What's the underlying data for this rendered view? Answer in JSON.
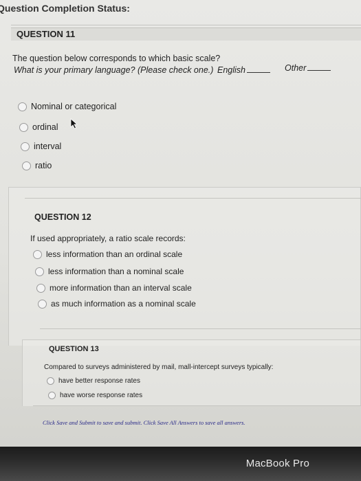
{
  "status_title": "Question Completion Status:",
  "question11": {
    "header": "QUESTION 11",
    "prompt": "The question below corresponds to which basic scale?",
    "subprompt": "What is your primary language? (Please check one.)",
    "choice_a": "English",
    "choice_b": "Other",
    "options": [
      "Nominal or categorical",
      "ordinal",
      "interval",
      "ratio"
    ]
  },
  "question12": {
    "header": "QUESTION 12",
    "prompt": "If used appropriately, a ratio scale records:",
    "options": [
      "less information than an ordinal scale",
      "less information than a nominal scale",
      "more information than an interval scale",
      "as much information as a nominal scale"
    ]
  },
  "question13": {
    "header": "QUESTION 13",
    "prompt": "Compared to surveys administered by mail, mall-intercept surveys typically:",
    "options": [
      "have better response rates",
      "have worse response rates"
    ]
  },
  "footer": "Click Save and Submit to save and submit. Click Save All Answers to save all answers.",
  "brand": "MacBook Pro"
}
